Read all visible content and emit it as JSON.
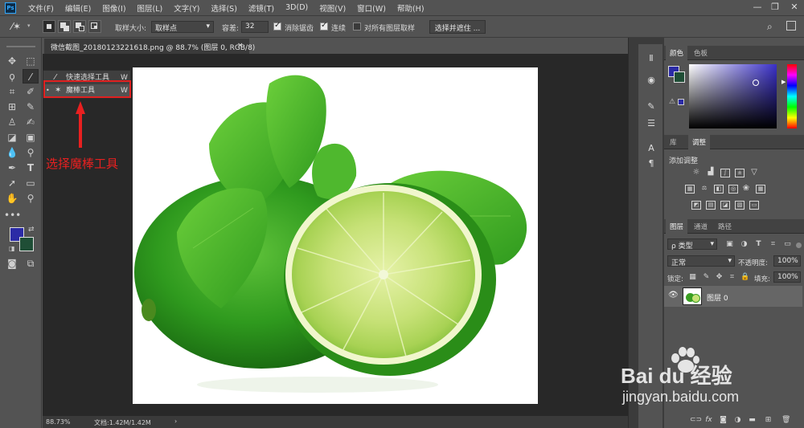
{
  "app": {
    "logo": "Ps"
  },
  "menubar": {
    "items": [
      "文件(F)",
      "编辑(E)",
      "图像(I)",
      "图层(L)",
      "文字(Y)",
      "选择(S)",
      "滤镜(T)",
      "3D(D)",
      "视图(V)",
      "窗口(W)",
      "帮助(H)"
    ],
    "minimize": "—",
    "restore": "❐",
    "close": "✕"
  },
  "options": {
    "sample_size_label": "取样大小:",
    "sample_size_value": "取样点",
    "tolerance_label": "容差:",
    "tolerance_value": "32",
    "antialias_label": "消除锯齿",
    "antialias_checked": true,
    "contiguous_label": "连续",
    "contiguous_checked": true,
    "all_layers_label": "对所有图层取样",
    "all_layers_checked": false,
    "select_mask_button": "选择并遮住 ..."
  },
  "document": {
    "tab_title": "微信截图_20180123221618.png @ 88.7% (图层 0, RGB/8)",
    "tab_close": "×",
    "zoom": "88.73%",
    "doc_info": "文档:1.42M/1.42M",
    "status_arrow": "›"
  },
  "flyout": {
    "items": [
      {
        "label": "快速选择工具",
        "shortcut": "W"
      },
      {
        "label": "魔棒工具",
        "shortcut": "W"
      }
    ]
  },
  "annotation": {
    "text": "选择魔棒工具"
  },
  "colors": {
    "foreground": "#2b2ba6",
    "background": "#1f4e36",
    "annotation": "#e82020",
    "workspace": "#535353",
    "doc_bg": "#282828"
  },
  "color_panel": {
    "tabs": [
      "颜色",
      "色板"
    ],
    "hue_color": "#3a30c8"
  },
  "adjust_panel": {
    "tabs": [
      "库",
      "调整"
    ],
    "add_label": "添加调整"
  },
  "layers_panel": {
    "tabs": [
      "图层",
      "通道",
      "路径"
    ],
    "kind_label": "ρ 类型",
    "blend_mode": "正常",
    "opacity_label": "不透明度:",
    "opacity_value": "100%",
    "lock_label": "锁定:",
    "fill_label": "填充:",
    "fill_value": "100%",
    "layer_name": "图层 0"
  },
  "watermark": {
    "brand": "Bai du 经验",
    "url": "jingyan.baidu.com"
  }
}
